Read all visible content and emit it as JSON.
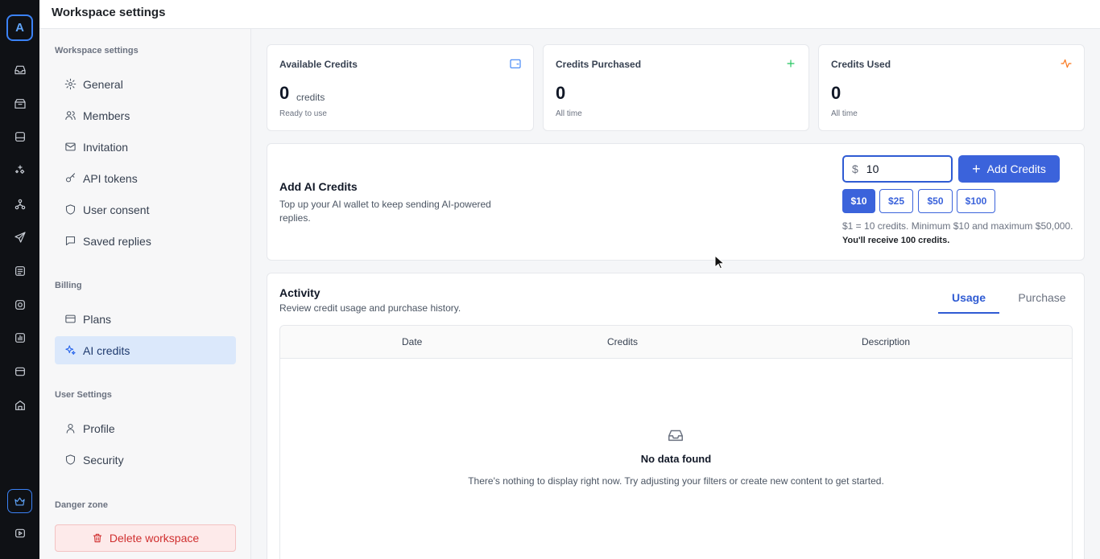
{
  "app": {
    "logo_letter": "A",
    "page_title": "Workspace settings"
  },
  "rail_icons": [
    "inbox-icon",
    "archive-icon",
    "database-icon",
    "sparkles-icon",
    "workflow-icon",
    "send-icon",
    "list-icon",
    "instagram-icon",
    "chart-icon",
    "card-icon",
    "shop-icon",
    "crown-icon",
    "video-icon"
  ],
  "sidebar": {
    "sections": {
      "workspace": "Workspace settings",
      "billing": "Billing",
      "user": "User Settings",
      "danger": "Danger zone"
    },
    "items": {
      "general": "General",
      "members": "Members",
      "invitation": "Invitation",
      "api_tokens": "API tokens",
      "user_consent": "User consent",
      "saved_replies": "Saved replies",
      "plans": "Plans",
      "ai_credits": "AI credits",
      "profile": "Profile",
      "security": "Security"
    },
    "active_item": "ai_credits",
    "delete_label": "Delete workspace"
  },
  "stats": {
    "available": {
      "label": "Available Credits",
      "value": "0",
      "unit": "credits",
      "sub": "Ready to use",
      "icon": "wallet-icon",
      "color": "#3b82f6"
    },
    "purchased": {
      "label": "Credits Purchased",
      "value": "0",
      "sub": "All time",
      "icon": "plus-icon",
      "color": "#22c55e"
    },
    "used": {
      "label": "Credits Used",
      "value": "0",
      "sub": "All time",
      "icon": "activity-icon",
      "color": "#f97316"
    }
  },
  "add_credits": {
    "title": "Add AI Credits",
    "description": "Top up your AI wallet to keep sending AI-powered replies.",
    "currency": "$",
    "amount": "10",
    "button": "Add Credits",
    "presets": [
      "$10",
      "$25",
      "$50",
      "$100"
    ],
    "selected_preset": "$10",
    "note": "$1 = 10 credits. Minimum $10 and maximum $50,000.",
    "receive": "You'll receive 100 credits."
  },
  "activity": {
    "title": "Activity",
    "description": "Review credit usage and purchase history.",
    "tabs": [
      "Usage",
      "Purchase"
    ],
    "active_tab": "Usage",
    "columns": [
      "Date",
      "Credits",
      "Description"
    ],
    "empty_title": "No data found",
    "empty_desc": "There's nothing to display right now. Try adjusting your filters or create new content to get started."
  },
  "colors": {
    "accent": "#3b63db",
    "danger": "#d03030",
    "rail": "#0f1115"
  }
}
